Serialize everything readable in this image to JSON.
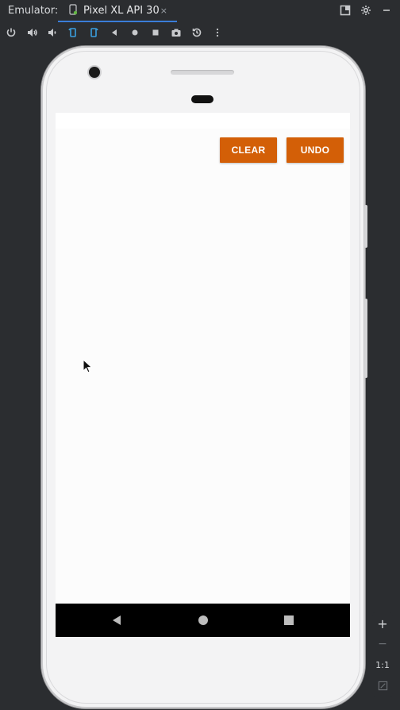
{
  "app": {
    "toolwindow_label": "Emulator:",
    "tab_title": "Pixel XL API 30",
    "tab_close_symbol": "×"
  },
  "toolbar": {
    "tools": [
      {
        "name": "power-icon"
      },
      {
        "name": "volume-up-icon"
      },
      {
        "name": "volume-down-icon"
      },
      {
        "name": "rotate-left-icon"
      },
      {
        "name": "rotate-right-icon"
      },
      {
        "name": "back-icon"
      },
      {
        "name": "home-icon"
      },
      {
        "name": "overview-icon"
      },
      {
        "name": "camera-screenshot-icon"
      },
      {
        "name": "snapshot-icon"
      },
      {
        "name": "more-options-icon"
      }
    ]
  },
  "app_screen": {
    "buttons": {
      "clear_label": "CLEAR",
      "undo_label": "UNDO"
    }
  },
  "zoom": {
    "plus": "+",
    "minus": "−",
    "one_to_one": "1:1"
  },
  "colors": {
    "accent_button": "#d35f07",
    "screen_bg": "#fcfcfc",
    "phone_body": "#f3f3f4",
    "ide_bg": "#2b2d30",
    "tab_underline": "#3a7dd8"
  }
}
